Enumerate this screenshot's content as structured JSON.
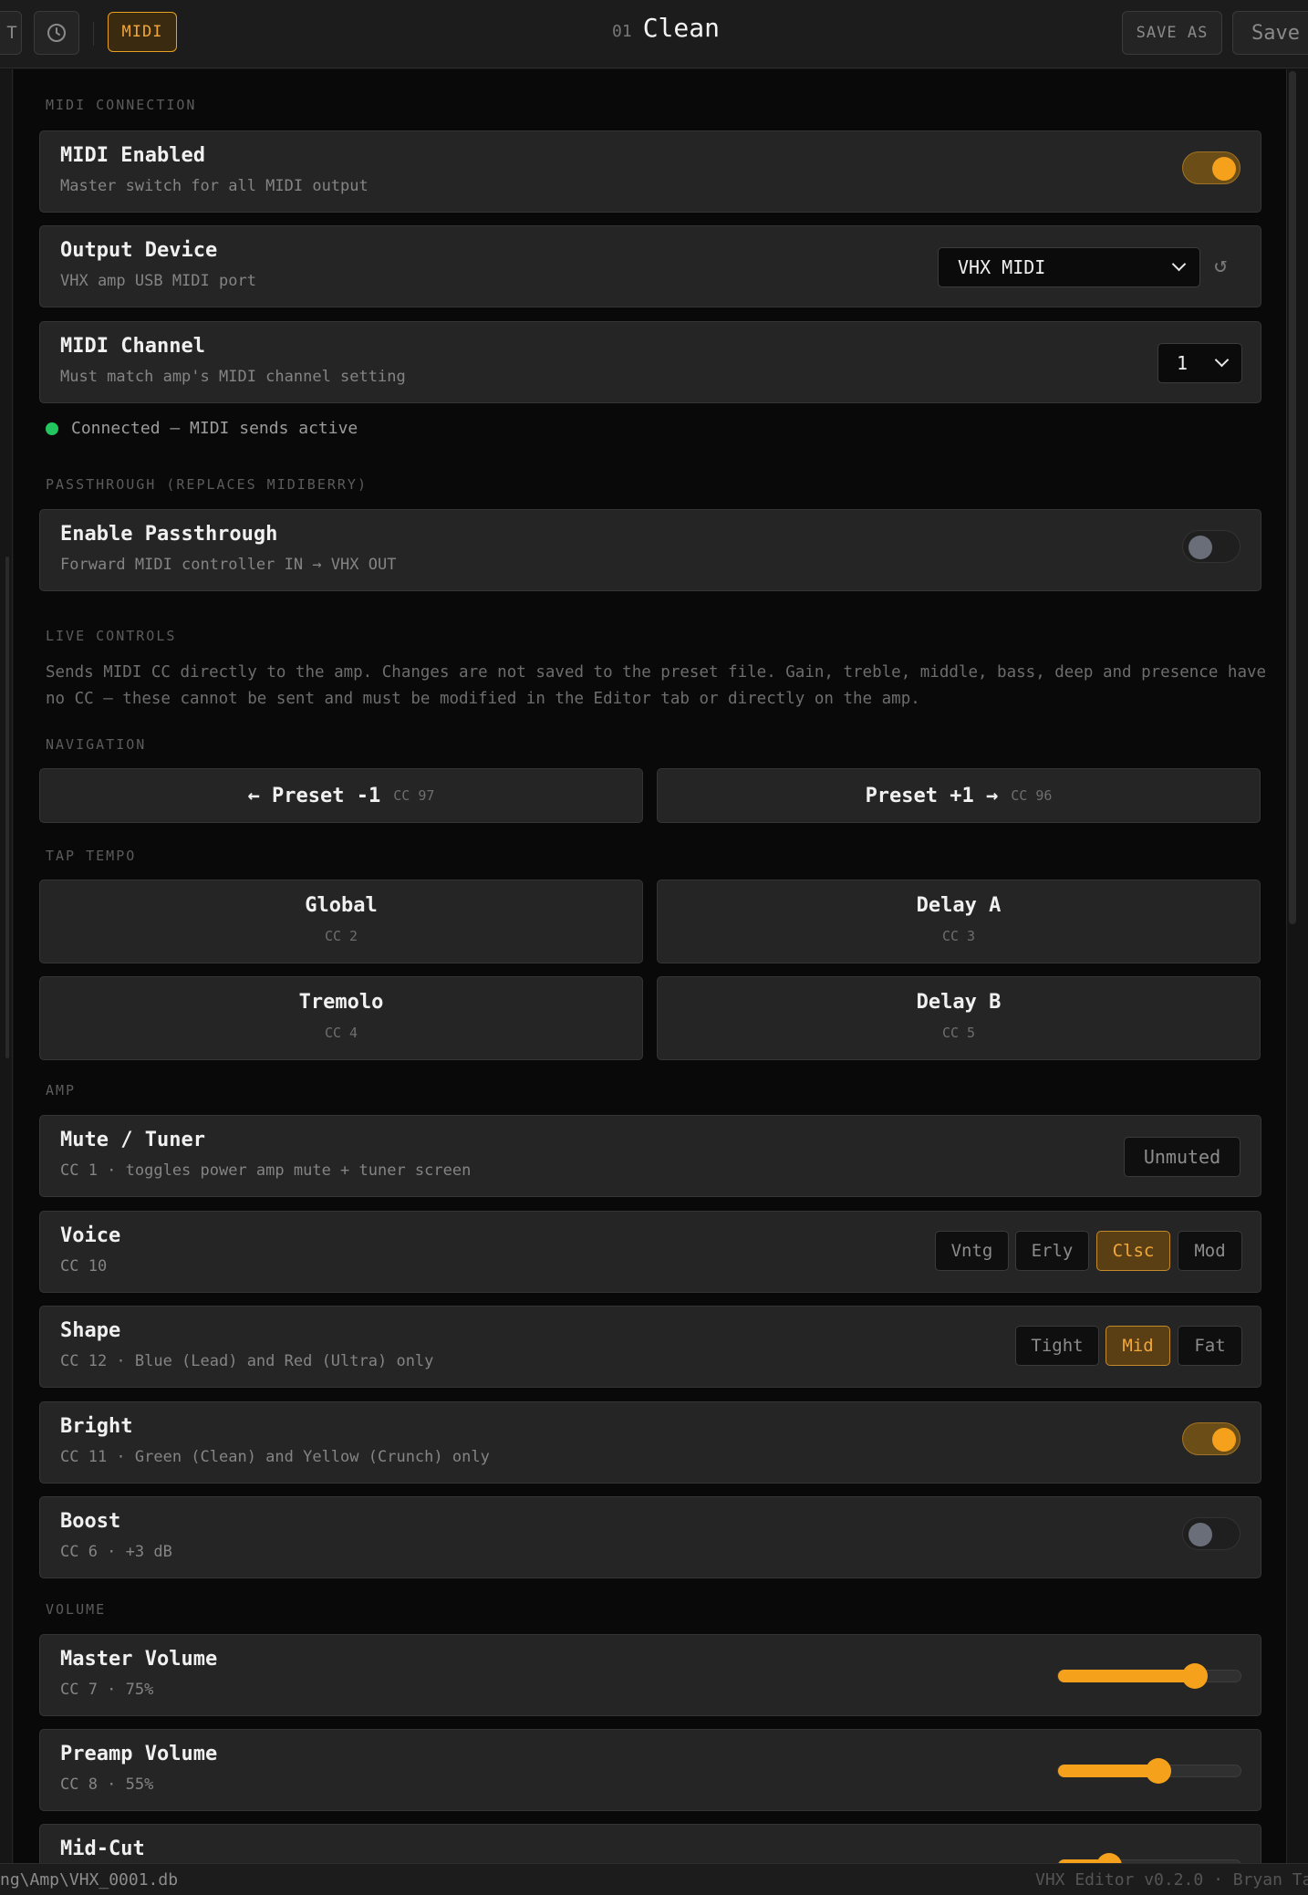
{
  "topbar": {
    "cut_label": "T",
    "midi_label": "MIDI",
    "preset_number": "01",
    "preset_name": "Clean",
    "save_as_label": "SAVE AS",
    "save_label": "Save"
  },
  "connection": {
    "section": "MIDI CONNECTION",
    "midi_enabled": {
      "title": "MIDI Enabled",
      "subtitle": "Master switch for all MIDI output",
      "on": true
    },
    "output_device": {
      "title": "Output Device",
      "subtitle": "VHX amp USB MIDI port",
      "value": "VHX MIDI",
      "refresh_icon": "↺"
    },
    "midi_channel": {
      "title": "MIDI Channel",
      "subtitle": "Must match amp's MIDI channel setting",
      "value": "1"
    },
    "status": "Connected — MIDI sends active",
    "status_color": "#22c55e"
  },
  "passthrough": {
    "section": "PASSTHROUGH (REPLACES MIDIBERRY)",
    "title": "Enable Passthrough",
    "subtitle": "Forward MIDI controller IN → VHX OUT",
    "on": false
  },
  "live": {
    "section": "LIVE CONTROLS",
    "description": "Sends MIDI CC directly to the amp. Changes are not saved to the preset file. Gain, treble, middle, bass, deep and presence have no CC — these cannot be sent and must be modified in the Editor tab or directly on the amp."
  },
  "navigation": {
    "section": "NAVIGATION",
    "prev": {
      "label": "← Preset -1",
      "cc": "CC 97"
    },
    "next": {
      "label": "Preset +1 →",
      "cc": "CC 96"
    }
  },
  "tap": {
    "section": "TAP TEMPO",
    "buttons": [
      {
        "label": "Global",
        "cc": "CC 2"
      },
      {
        "label": "Delay A",
        "cc": "CC 3"
      },
      {
        "label": "Tremolo",
        "cc": "CC 4"
      },
      {
        "label": "Delay B",
        "cc": "CC 5"
      }
    ]
  },
  "amp": {
    "section": "AMP",
    "mute": {
      "title": "Mute / Tuner",
      "subtitle": "CC 1 · toggles power amp mute + tuner screen",
      "button": "Unmuted"
    },
    "voice": {
      "title": "Voice",
      "subtitle": "CC 10",
      "options": [
        "Vntg",
        "Erly",
        "Clsc",
        "Mod"
      ],
      "selected": "Clsc"
    },
    "shape": {
      "title": "Shape",
      "subtitle": "CC 12 · Blue (Lead) and Red (Ultra) only",
      "options": [
        "Tight",
        "Mid",
        "Fat"
      ],
      "selected": "Mid"
    },
    "bright": {
      "title": "Bright",
      "subtitle": "CC 11 · Green (Clean) and Yellow (Crunch) only",
      "on": true
    },
    "boost": {
      "title": "Boost",
      "subtitle": "CC 6 · +3 dB",
      "on": false
    }
  },
  "volume": {
    "section": "VOLUME",
    "master": {
      "title": "Master Volume",
      "subtitle": "CC 7 · 75%",
      "value": 0.75
    },
    "preamp": {
      "title": "Preamp Volume",
      "subtitle": "CC 8 · 55%",
      "value": 0.55
    },
    "midcut": {
      "title": "Mid-Cut",
      "value": 0.28
    }
  },
  "statusbar": {
    "path": "ng\\Amp\\VHX_0001.db",
    "app": "VHX Editor v0.2.0 · Bryan Ta"
  },
  "colors": {
    "accent": "#f6a11c",
    "panel": "#252525",
    "background": "#090909"
  }
}
